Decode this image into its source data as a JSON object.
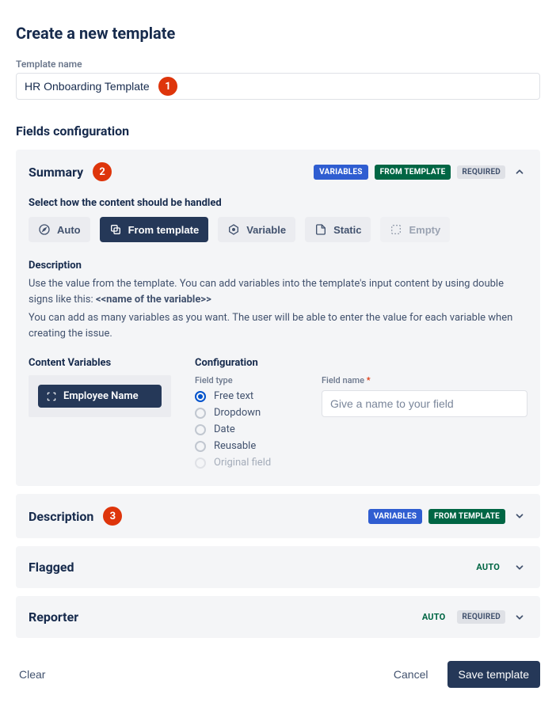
{
  "page_title": "Create a new template",
  "template_name": {
    "label": "Template name",
    "value": "HR Onboarding Template",
    "badge": "1"
  },
  "fields_config_title": "Fields configuration",
  "summary": {
    "title": "Summary",
    "badge": "2",
    "tags": {
      "variables": "VARIABLES",
      "from_template": "FROM TEMPLATE",
      "required": "REQUIRED"
    },
    "handling_label": "Select how the content should be handled",
    "modes": {
      "auto": "Auto",
      "from_template": "From template",
      "variable": "Variable",
      "static": "Static",
      "empty": "Empty"
    },
    "description_heading": "Description",
    "description_line1_pre": "Use the value from the template. You can add variables into the template's input content by using double signs like this: ",
    "description_line1_bold": "<<name of the variable>>",
    "description_line2": "You can add as many variables as you want. The user will be able to enter the value for each variable when creating the issue.",
    "content_vars_title": "Content Variables",
    "var_chip": "Employee Name",
    "config_title": "Configuration",
    "field_type_label": "Field type",
    "field_types": {
      "free_text": "Free text",
      "dropdown": "Dropdown",
      "date": "Date",
      "reusable": "Reusable",
      "original": "Original field"
    },
    "field_name_label": "Field name",
    "field_name_placeholder": "Give a name to your field"
  },
  "description_panel": {
    "title": "Description",
    "badge": "3",
    "tags": {
      "variables": "VARIABLES",
      "from_template": "FROM TEMPLATE"
    }
  },
  "flagged_panel": {
    "title": "Flagged",
    "tags": {
      "auto": "AUTO"
    }
  },
  "reporter_panel": {
    "title": "Reporter",
    "tags": {
      "auto": "AUTO",
      "required": "REQUIRED"
    }
  },
  "footer": {
    "clear": "Clear",
    "cancel": "Cancel",
    "save": "Save template"
  }
}
